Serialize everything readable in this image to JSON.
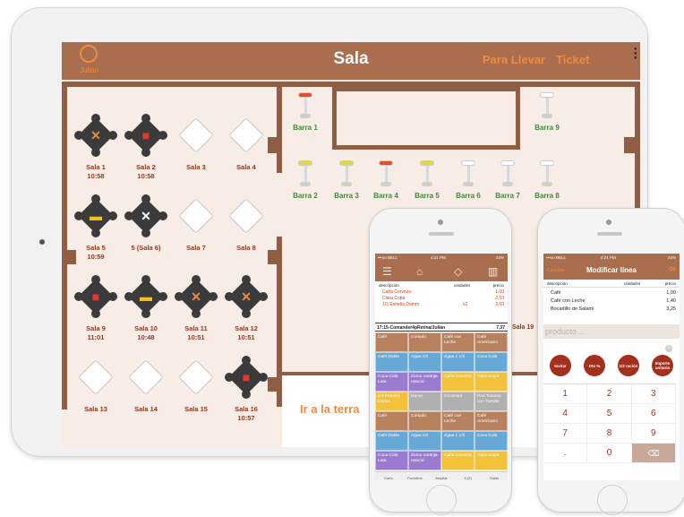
{
  "ipad": {
    "title": "Sala",
    "user_name": "Julián",
    "link_para_llevar": "Para Llevar",
    "link_ticket": "Ticket",
    "terrace_link": "Ir a la terra",
    "tables": [
      {
        "label": "Sala 1",
        "time": "10:58",
        "status": "occupied",
        "icon": "fork-knife-icon",
        "glyph": "✕",
        "color": "#f08a3e"
      },
      {
        "label": "Sala 2",
        "time": "10:58",
        "status": "occupied",
        "icon": "receipt-icon",
        "glyph": "■",
        "color": "#e23a2a"
      },
      {
        "label": "Sala 3",
        "time": "",
        "status": "free",
        "icon": "",
        "glyph": "",
        "color": ""
      },
      {
        "label": "Sala 4",
        "time": "",
        "status": "free",
        "icon": "",
        "glyph": "",
        "color": ""
      },
      {
        "label": "Sala 5",
        "time": "10:59",
        "status": "occupied",
        "icon": "coffee-cup-icon",
        "glyph": "▬",
        "color": "#f2c21a"
      },
      {
        "label": "5 (Sala 6)",
        "time": "",
        "status": "occupied",
        "icon": "x-icon",
        "glyph": "✕",
        "color": "#ffffff"
      },
      {
        "label": "Sala 7",
        "time": "",
        "status": "free",
        "icon": "",
        "glyph": "",
        "color": ""
      },
      {
        "label": "Sala 8",
        "time": "",
        "status": "free",
        "icon": "",
        "glyph": "",
        "color": ""
      },
      {
        "label": "Sala 9",
        "time": "11:01",
        "status": "occupied",
        "icon": "receipt-icon",
        "glyph": "■",
        "color": "#e23a2a"
      },
      {
        "label": "Sala 10",
        "time": "10:48",
        "status": "occupied",
        "icon": "coffee-cup-icon",
        "glyph": "▬",
        "color": "#f2c21a"
      },
      {
        "label": "Sala 11",
        "time": "10:51",
        "status": "occupied",
        "icon": "fork-knife-icon",
        "glyph": "✕",
        "color": "#f08a3e"
      },
      {
        "label": "Sala 12",
        "time": "10:51",
        "status": "occupied",
        "icon": "fork-knife-icon",
        "glyph": "✕",
        "color": "#f08a3e"
      },
      {
        "label": "Sala 13",
        "time": "",
        "status": "free",
        "icon": "",
        "glyph": "",
        "color": ""
      },
      {
        "label": "Sala 14",
        "time": "",
        "status": "free",
        "icon": "",
        "glyph": "",
        "color": ""
      },
      {
        "label": "Sala 15",
        "time": "",
        "status": "free",
        "icon": "",
        "glyph": "",
        "color": ""
      },
      {
        "label": "Sala 16",
        "time": "10:57",
        "status": "occupied",
        "icon": "receipt-icon",
        "glyph": "■",
        "color": "#e23a2a"
      }
    ],
    "barras": [
      {
        "label": "Barra 1",
        "seat": "#e44b2f"
      },
      {
        "label": "Barra 2",
        "seat": "#e0d83c"
      },
      {
        "label": "Barra 3",
        "seat": "#e0d83c"
      },
      {
        "label": "Barra 4",
        "seat": "#e44b2f"
      },
      {
        "label": "Barra 5",
        "seat": "#e0d83c"
      },
      {
        "label": "Barra 6",
        "seat": "#ffffff"
      },
      {
        "label": "Barra 7",
        "seat": "#ffffff"
      },
      {
        "label": "Barra 8",
        "seat": "#ffffff"
      },
      {
        "label": "Barra 9",
        "seat": "#ffffff"
      }
    ]
  },
  "phone1": {
    "status_carrier": "•••oo BELL",
    "status_time": "4:21 PM",
    "status_battery": "22%",
    "col_desc": "descripción",
    "col_units": "unidades",
    "col_price": "precio",
    "order_items": [
      {
        "desc": "Caña Cerveza",
        "units": "",
        "price": "1,00"
      },
      {
        "desc": "Clara Copa",
        "units": "",
        "price": "2,10"
      },
      {
        "desc": "1/3 Estrella Damm",
        "units": "x2",
        "price": "3,60"
      }
    ],
    "summary_label": "17:15-Comander4pRetina/Julián",
    "summary_total": "7,37",
    "products": [
      {
        "name": "Café",
        "color": "#b7815e"
      },
      {
        "name": "Cortado",
        "color": "#b7815e"
      },
      {
        "name": "Café con Leche",
        "color": "#b7815e"
      },
      {
        "name": "Café Americano",
        "color": "#b7815e"
      },
      {
        "name": "Café Doble",
        "color": "#67a9d6"
      },
      {
        "name": "Agua 1/3",
        "color": "#67a9d6"
      },
      {
        "name": "Agua 1 1/2",
        "color": "#67a9d6"
      },
      {
        "name": "Coca Cola",
        "color": "#67a9d6"
      },
      {
        "name": "Coca Cola Lata",
        "color": "#9a7bd0"
      },
      {
        "name": "Zumo naranja natural",
        "color": "#9a7bd0"
      },
      {
        "name": "Caña Cerveza",
        "color": "#f3c23a"
      },
      {
        "name": "Clara Copa",
        "color": "#f3c23a"
      },
      {
        "name": "1/3 Estrella Damm",
        "color": "#f3c23a"
      },
      {
        "name": "Donut",
        "color": "#b0b0b0"
      },
      {
        "name": "Croissant",
        "color": "#b0b0b0"
      },
      {
        "name": "Pan Tostado con Tomate",
        "color": "#b0b0b0"
      },
      {
        "name": "Café",
        "color": "#b7815e"
      },
      {
        "name": "Cortado",
        "color": "#b7815e"
      },
      {
        "name": "Café con Leche",
        "color": "#b7815e"
      },
      {
        "name": "Café Americano",
        "color": "#b7815e"
      },
      {
        "name": "Café Doble",
        "color": "#67a9d6"
      },
      {
        "name": "Agua 1/3",
        "color": "#67a9d6"
      },
      {
        "name": "Agua 1 1/2",
        "color": "#67a9d6"
      },
      {
        "name": "Coca Cola",
        "color": "#67a9d6"
      },
      {
        "name": "Coca Cola Lata",
        "color": "#9a7bd0"
      },
      {
        "name": "Zumo naranja natural",
        "color": "#9a7bd0"
      },
      {
        "name": "Caña Cerveza",
        "color": "#f3c23a"
      },
      {
        "name": "Clara Copa",
        "color": "#f3c23a"
      }
    ],
    "tabs": [
      {
        "label": "Carta"
      },
      {
        "label": "Favoritos"
      },
      {
        "label": "Ampliar"
      },
      {
        "label": "4 (2)"
      },
      {
        "label": "Salas"
      }
    ]
  },
  "phone2": {
    "status_carrier": "•••oo BELL",
    "status_time": "4:21 PM",
    "status_battery": "22%",
    "cancel_label": "Cancelar",
    "title": "Modificar línea",
    "ok_label": "Ok",
    "col_desc": "descripción",
    "col_units": "unidades",
    "col_price": "precio",
    "lines": [
      {
        "desc": "Café",
        "price": "1,00"
      },
      {
        "desc": "Café con Leche",
        "price": "1,40"
      },
      {
        "desc": "Bocadillo de Salami",
        "price": "3,25"
      }
    ],
    "product_placeholder": "producto...",
    "actions": [
      "Invitar",
      "Dto %",
      "1/2 ración",
      "Importe unitario"
    ],
    "keys": [
      "1",
      "2",
      "3",
      "4",
      "5",
      "6",
      "7",
      "8",
      "9",
      ".",
      "0",
      "⌫"
    ],
    "peek_label": "Sala 19"
  }
}
